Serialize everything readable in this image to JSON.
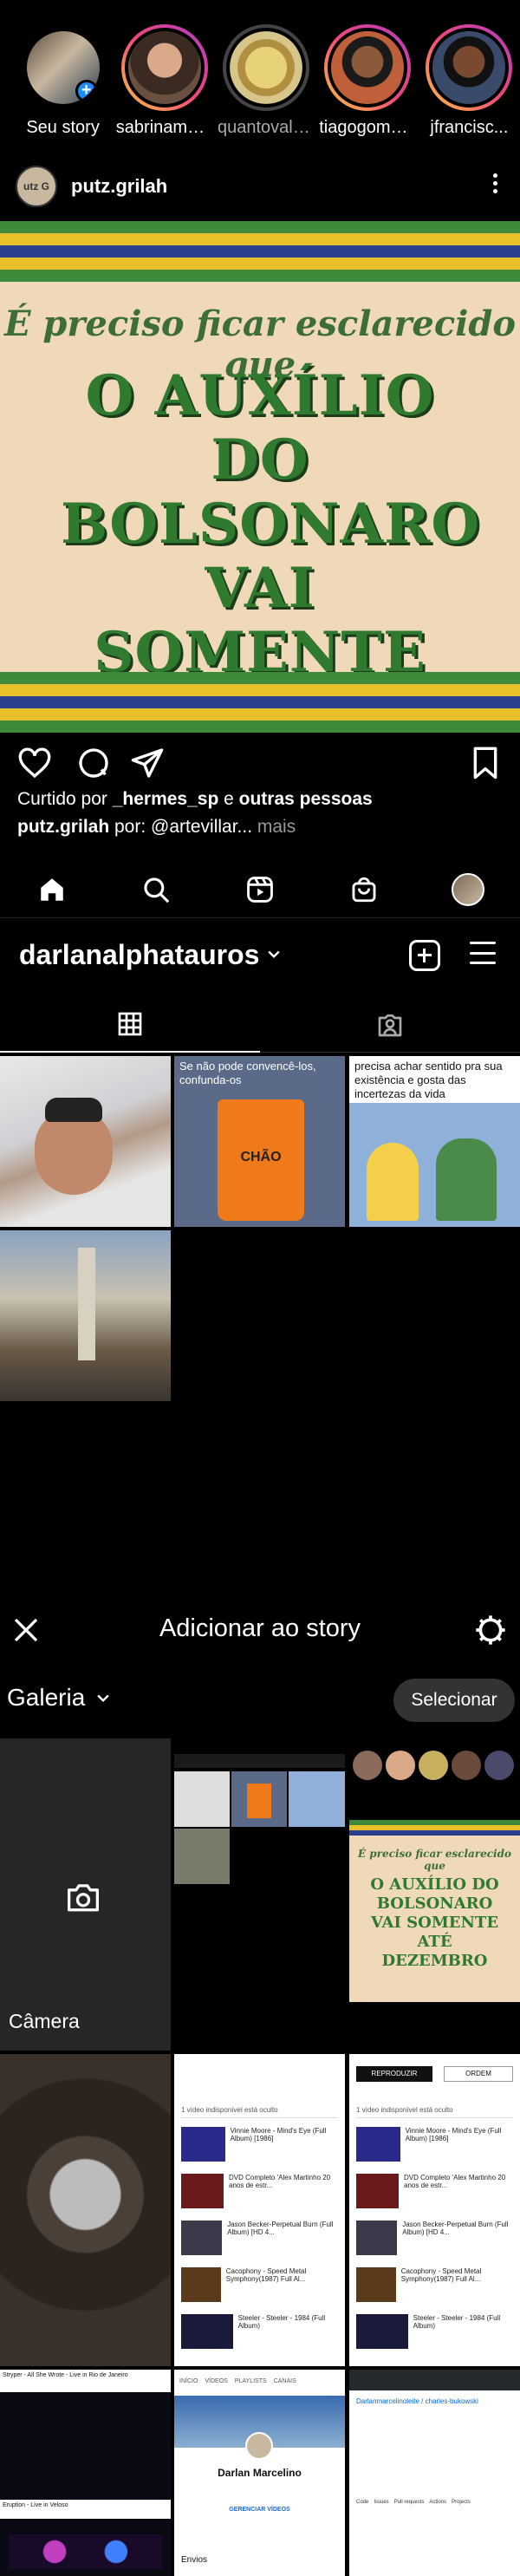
{
  "stories": [
    {
      "name": "Seu story",
      "seen": false,
      "own": true
    },
    {
      "name": "sabrinamen...",
      "seen": false
    },
    {
      "name": "quantovale...",
      "seen": true
    },
    {
      "name": "tiagogomez...",
      "seen": false
    },
    {
      "name": "jfrancisc...",
      "seen": false
    }
  ],
  "post": {
    "username": "putz.grilah",
    "avatar_text": "utz G",
    "image_line1": "É preciso ficar esclarecido que",
    "image_line2": "O AUXÍLIO DO BOLSONARO VAI SOMENTE ATÉ DEZEMBRO",
    "liked_by_prefix": "Curtido por ",
    "liked_by_user": "_hermes_sp",
    "liked_by_mid": " e ",
    "liked_by_rest": "outras pessoas",
    "caption_user": "putz.grilah",
    "caption_text": " por: @artevillar...",
    "caption_more": " mais"
  },
  "profile": {
    "username": "darlanalphatauros",
    "grid": [
      {
        "caption": ""
      },
      {
        "caption": "Se não pode convencê-los, confunda-os",
        "bin_label": "CHÃO"
      },
      {
        "caption": "precisa achar sentido pra sua existência e gosta das incertezas da vida"
      },
      {
        "caption": ""
      }
    ]
  },
  "story_picker": {
    "title": "Adicionar ao story",
    "gallery_label": "Galeria",
    "select_label": "Selecionar",
    "camera_label": "Câmera",
    "thumb_playlist_header": "1 vídeo indisponível está oculto",
    "thumb_playlist_items": [
      "Vinnie Moore - Mind's Eye (Full Album) [1986]",
      "DVD Completo 'Alex Martinho 20 anos de estr...",
      "Jason Becker-Perpetual Burn (Full Album) [HD 4...",
      "Cacophony - Speed Metal Symphony(1987) Full Al...",
      "Steeler - Steeler - 1984 (Full Album)"
    ],
    "thumb_reproduzir": "REPRODUZIR",
    "thumb_ordem": "ORDEM",
    "thumb_video_title": "Stryper - All She Wrote - Live in Rio de Janeiro",
    "thumb_video_title2": "Eruption - Live in Veloso",
    "thumb_channel_name": "Darlan Marcelino",
    "thumb_channel_tabs": [
      "INÍCIO",
      "VÍDEOS",
      "PLAYLISTS",
      "CANAIS"
    ],
    "thumb_channel_manage": "GERENCIAR VÍDEOS",
    "thumb_channel_envios": "Envios",
    "thumb_gh_user": "Darlanmarcelinoleite / charles-bukowski",
    "thumb_gh_tabs": [
      "Code",
      "Issues",
      "Pull requests",
      "Actions",
      "Projects"
    ]
  },
  "colors": {
    "accent_blue": "#1a8cff",
    "post_bg": "#efd9b8",
    "post_green": "#2f7a2f",
    "stripe_green": "#3f8a3a",
    "stripe_yellow": "#e8c02a",
    "stripe_blue": "#2b3f8f"
  },
  "icons": {
    "like": "heart-icon",
    "comment": "comment-icon",
    "share": "send-icon",
    "save": "bookmark-icon",
    "home": "home-icon",
    "search": "search-icon",
    "reels": "reels-icon",
    "shop": "shop-icon"
  }
}
